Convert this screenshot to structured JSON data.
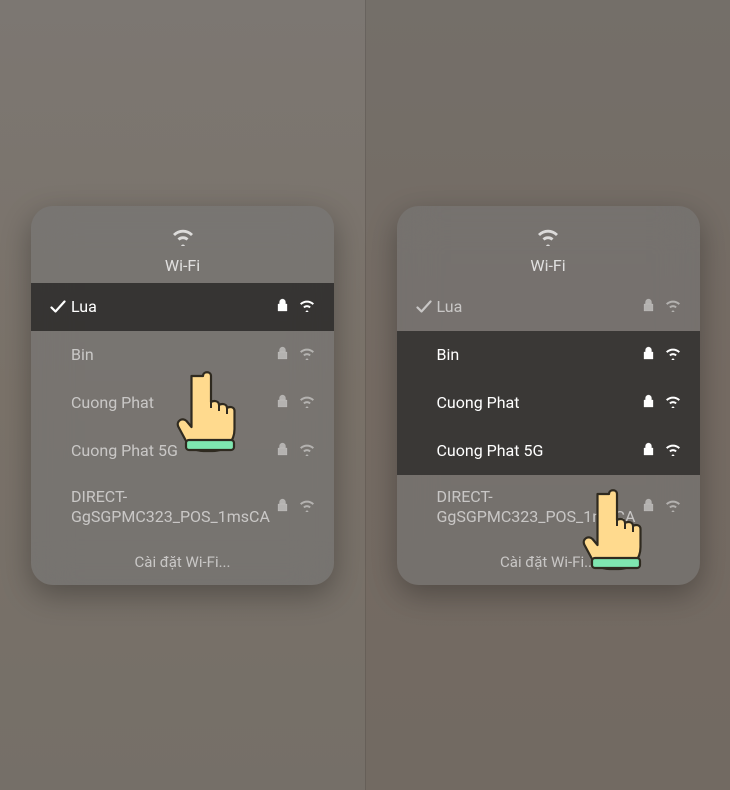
{
  "title": "Wi-Fi",
  "settings_label": "Cài đặt Wi-Fi...",
  "left": {
    "networks": [
      {
        "name": "Lua",
        "connected": true,
        "secured": true,
        "state": "selected"
      },
      {
        "name": "Bin",
        "connected": false,
        "secured": true,
        "state": ""
      },
      {
        "name": "Cuong Phat",
        "connected": false,
        "secured": true,
        "state": ""
      },
      {
        "name": "Cuong Phat 5G",
        "connected": false,
        "secured": true,
        "state": ""
      },
      {
        "name": "DIRECT-GgSGPMC323_POS_1msCA",
        "connected": false,
        "secured": true,
        "state": "",
        "tall": true
      }
    ]
  },
  "right": {
    "networks": [
      {
        "name": "Lua",
        "connected": true,
        "secured": true,
        "state": ""
      },
      {
        "name": "Bin",
        "connected": false,
        "secured": true,
        "state": "hovered"
      },
      {
        "name": "Cuong Phat",
        "connected": false,
        "secured": true,
        "state": "hovered"
      },
      {
        "name": "Cuong Phat 5G",
        "connected": false,
        "secured": true,
        "state": "hovered"
      },
      {
        "name": "DIRECT-GgSGPMC323_POS_1msCA",
        "connected": false,
        "secured": true,
        "state": "",
        "tall": true
      }
    ]
  }
}
